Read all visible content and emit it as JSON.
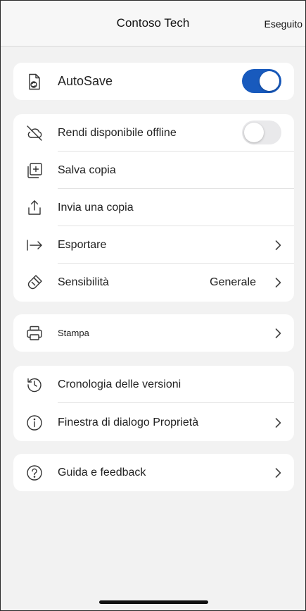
{
  "header": {
    "title": "Contoso Tech",
    "done_label": "Eseguito"
  },
  "autosave": {
    "label": "AutoSave",
    "enabled": true
  },
  "file_actions": {
    "offline": {
      "label": "Rendi disponibile offline",
      "enabled": false
    },
    "save_copy": {
      "label": "Salva copia"
    },
    "send_copy": {
      "label": "Invia una copia"
    },
    "export": {
      "label": "Esportare"
    },
    "sensitivity": {
      "label": "Sensibilità",
      "value": "Generale"
    }
  },
  "print": {
    "label": "Stampa"
  },
  "history": {
    "version_history": {
      "label": "Cronologia delle versioni"
    },
    "properties": {
      "label": "Finestra di dialogo Proprietà"
    }
  },
  "help": {
    "label": "Guida e feedback"
  },
  "colors": {
    "accent": "#185abd",
    "background": "#f2f2f2",
    "card": "#ffffff"
  }
}
